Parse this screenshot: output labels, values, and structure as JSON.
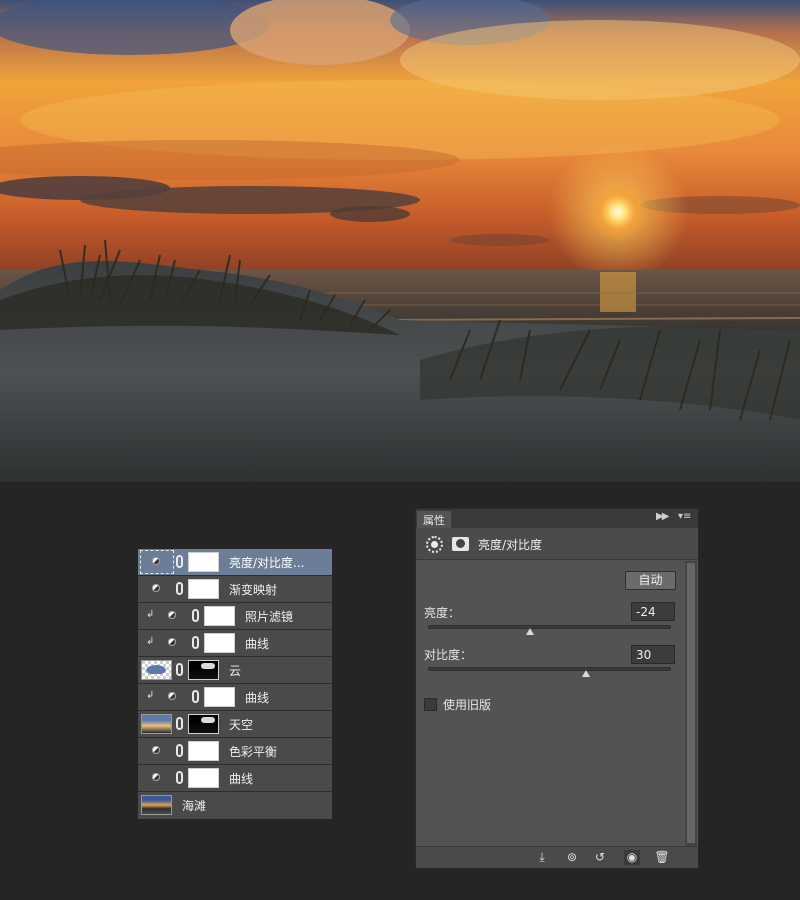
{
  "layers": [
    {
      "name": "亮度/对比度...",
      "type": "adjustment",
      "clipped": false,
      "selected": true
    },
    {
      "name": "渐变映射",
      "type": "adjustment",
      "clipped": false,
      "selected": false
    },
    {
      "name": "照片滤镜",
      "type": "adjustment",
      "clipped": true,
      "selected": false
    },
    {
      "name": "曲线",
      "type": "adjustment",
      "clipped": true,
      "selected": false
    },
    {
      "name": "云",
      "type": "image",
      "thumb": "cloud",
      "selected": false
    },
    {
      "name": "曲线",
      "type": "adjustment",
      "clipped": true,
      "selected": false
    },
    {
      "name": "天空",
      "type": "image",
      "thumb": "sky",
      "selected": false
    },
    {
      "name": "色彩平衡",
      "type": "adjustment",
      "clipped": false,
      "selected": false
    },
    {
      "name": "曲线",
      "type": "adjustment",
      "clipped": false,
      "selected": false
    },
    {
      "name": "海滩",
      "type": "background",
      "thumb": "beach",
      "selected": false
    }
  ],
  "properties": {
    "tab_label": "属性",
    "adjustment_title": "亮度/对比度",
    "auto_button": "自动",
    "brightness": {
      "label": "亮度：",
      "value": "-24",
      "slider_fraction": 0.42
    },
    "contrast": {
      "label": "对比度：",
      "value": "30",
      "slider_fraction": 0.65
    },
    "legacy_label": "使用旧版",
    "legacy_checked": false
  },
  "colors": {
    "selected_layer": "#6b7d97",
    "panel_bg": "#535353",
    "app_bg": "#252525"
  }
}
